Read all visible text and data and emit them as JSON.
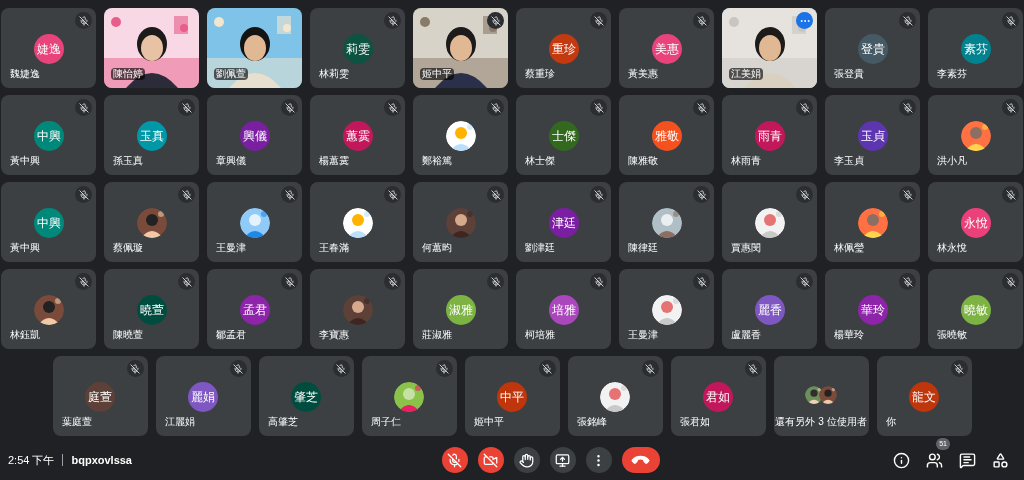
{
  "rows": [
    [
      {
        "kind": "initials",
        "initials": "婕逸",
        "color": "#e8437a",
        "name": "魏婕逸",
        "muted": true
      },
      {
        "kind": "video",
        "name": "陳怡婷",
        "muted": false
      },
      {
        "kind": "video",
        "name": "劉佩萱",
        "muted": false
      },
      {
        "kind": "initials",
        "initials": "莉雯",
        "color": "#0d5341",
        "name": "林莉雯",
        "muted": true
      },
      {
        "kind": "video",
        "name": "姬中平",
        "muted": true
      },
      {
        "kind": "initials",
        "initials": "重珍",
        "color": "#c43a10",
        "name": "蔡重珍",
        "muted": true
      },
      {
        "kind": "initials",
        "initials": "美惠",
        "color": "#e8437a",
        "name": "黃美惠",
        "muted": true
      },
      {
        "kind": "video",
        "name": "江美娟",
        "hovered": true
      },
      {
        "kind": "initials",
        "initials": "登貴",
        "color": "#455a64",
        "name": "張登貴",
        "muted": true
      },
      {
        "kind": "initials",
        "initials": "素芬",
        "color": "#00838f",
        "name": "李素芬",
        "muted": true
      }
    ],
    [
      {
        "kind": "initials",
        "initials": "中興",
        "color": "#00897b",
        "name": "黃中興",
        "muted": true
      },
      {
        "kind": "initials",
        "initials": "玉真",
        "color": "#0097a7",
        "name": "孫玉真",
        "muted": true
      },
      {
        "kind": "initials",
        "initials": "興儀",
        "color": "#7b1fa2",
        "name": "章興儀",
        "muted": true
      },
      {
        "kind": "initials",
        "initials": "蕙霙",
        "color": "#c2185b",
        "name": "楊蕙霙",
        "muted": true
      },
      {
        "kind": "avatar",
        "name": "鄭裕篤",
        "muted": true
      },
      {
        "kind": "initials",
        "initials": "士傑",
        "color": "#33691e",
        "name": "林士傑",
        "muted": true
      },
      {
        "kind": "initials",
        "initials": "雅敬",
        "color": "#f4511e",
        "name": "陳雅敬",
        "muted": true
      },
      {
        "kind": "initials",
        "initials": "雨青",
        "color": "#c2185b",
        "name": "林雨青",
        "muted": true
      },
      {
        "kind": "initials",
        "initials": "玉貞",
        "color": "#5e35b1",
        "name": "李玉貞",
        "muted": true
      },
      {
        "kind": "avatar",
        "name": "洪小凡",
        "muted": true
      }
    ],
    [
      {
        "kind": "initials",
        "initials": "中興",
        "color": "#00897b",
        "name": "黃中興",
        "muted": true
      },
      {
        "kind": "avatar",
        "name": "蔡佩璇",
        "muted": true
      },
      {
        "kind": "avatar",
        "name": "王曼津",
        "muted": true
      },
      {
        "kind": "avatar",
        "name": "王春滿",
        "muted": true
      },
      {
        "kind": "avatar",
        "name": "何蕙昀",
        "muted": true
      },
      {
        "kind": "initials",
        "initials": "津廷",
        "color": "#7b1fa2",
        "name": "劉津廷",
        "muted": true
      },
      {
        "kind": "avatar",
        "name": "陳律廷",
        "muted": true
      },
      {
        "kind": "avatar",
        "name": "賈惠閔",
        "muted": true
      },
      {
        "kind": "avatar",
        "name": "林佩瑩",
        "muted": true
      },
      {
        "kind": "initials",
        "initials": "永悅",
        "color": "#ec407a",
        "name": "林永悅",
        "muted": true
      }
    ],
    [
      {
        "kind": "avatar",
        "name": "林鈺凱",
        "muted": true
      },
      {
        "kind": "initials",
        "initials": "曉萱",
        "color": "#004d40",
        "name": "陳曉萱",
        "muted": true
      },
      {
        "kind": "initials",
        "initials": "孟君",
        "color": "#8e24aa",
        "name": "鄒孟君",
        "muted": true
      },
      {
        "kind": "avatar",
        "name": "李寶惠",
        "muted": true
      },
      {
        "kind": "initials",
        "initials": "淑雅",
        "color": "#7cb342",
        "name": "莊淑雅",
        "muted": true
      },
      {
        "kind": "initials",
        "initials": "培雅",
        "color": "#ab47bc",
        "name": "柯培雅",
        "muted": true
      },
      {
        "kind": "avatar",
        "name": "王曼津",
        "muted": true
      },
      {
        "kind": "initials",
        "initials": "麗香",
        "color": "#7e57c2",
        "name": "盧麗香",
        "muted": true
      },
      {
        "kind": "initials",
        "initials": "華玲",
        "color": "#8e24aa",
        "name": "楊華玲",
        "muted": true
      },
      {
        "kind": "initials",
        "initials": "曉敏",
        "color": "#7cb342",
        "name": "張曉敏",
        "muted": true
      }
    ],
    [
      {
        "kind": "initials",
        "initials": "庭萱",
        "color": "#5d4037",
        "name": "葉庭萱",
        "muted": true
      },
      {
        "kind": "initials",
        "initials": "麗娟",
        "color": "#7e57c2",
        "name": "江麗娟",
        "muted": true
      },
      {
        "kind": "initials",
        "initials": "肇芝",
        "color": "#004d40",
        "name": "高肇芝",
        "muted": true
      },
      {
        "kind": "avatar",
        "name": "周子仁",
        "muted": true
      },
      {
        "kind": "initials",
        "initials": "中平",
        "color": "#bf360c",
        "name": "姬中平",
        "muted": true
      },
      {
        "kind": "avatar",
        "name": "張銘峰",
        "muted": true
      },
      {
        "kind": "initials",
        "initials": "君如",
        "color": "#c2185b",
        "name": "張君如",
        "muted": true
      },
      {
        "kind": "overflow",
        "name": "還有另外 3 位使用者"
      },
      {
        "kind": "initials",
        "initials": "龍文",
        "color": "#bf360c",
        "name": "你",
        "muted": true
      }
    ]
  ],
  "status": {
    "time": "2:54 下午",
    "meeting_code": "bqpxovlssa"
  },
  "controls": [
    {
      "kind": "mic",
      "off": true
    },
    {
      "kind": "camera",
      "off": true
    },
    {
      "kind": "hand"
    },
    {
      "kind": "present"
    },
    {
      "kind": "more"
    },
    {
      "kind": "hangup"
    }
  ],
  "side_buttons": [
    {
      "kind": "info"
    },
    {
      "kind": "people",
      "badge": "51"
    },
    {
      "kind": "chat"
    },
    {
      "kind": "activities"
    }
  ]
}
